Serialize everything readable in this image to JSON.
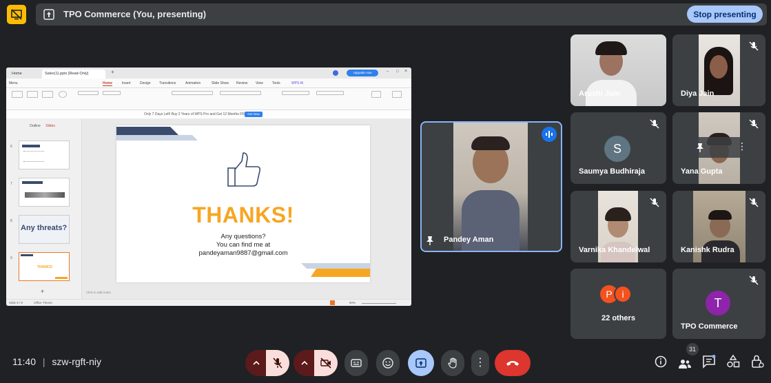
{
  "topbar": {
    "presenting_title": "TPO Commerce (You, presenting)",
    "stop_label": "Stop presenting"
  },
  "shared_screen": {
    "tabs": [
      "Home",
      "Sales(1).pptx [Read-Only]"
    ],
    "upgrade_label": "Upgrade now",
    "menu": [
      "Menu",
      "Home",
      "Insert",
      "Design",
      "Transitions",
      "Animation",
      "Slide Show",
      "Review",
      "View",
      "Tools",
      "WPS AI"
    ],
    "promo_text": "Only 7 Days Left! Buy 2 Years of WPS Pro and Get 12 Months FREE!",
    "promo_button": "Get Now",
    "panel_tabs": [
      "Outline",
      "Slides"
    ],
    "thumb_numbers": [
      "6",
      "7",
      "8",
      "9"
    ],
    "thumb_threats": "Any threats?",
    "thumb_thanks": "THANKS!",
    "notes_placeholder": "Click to add notes",
    "status_left": "Slide 9 / 9",
    "status_theme": "Office Theme",
    "zoom": "90%",
    "slide": {
      "title": "THANKS!",
      "line1": "Any questions?",
      "line2": "You can find me at",
      "line3": "pandeyaman9887@gmail.com"
    }
  },
  "participants": [
    {
      "name": "Pandey Aman"
    },
    {
      "name": "Arushi Jain"
    },
    {
      "name": "Diya Jain"
    },
    {
      "name": "Saumya Budhiraja",
      "initial": "S"
    },
    {
      "name": "Yana Gupta"
    },
    {
      "name": "Varnika Khandelwal"
    },
    {
      "name": "Kanishk Rudra"
    },
    {
      "name": "22 others",
      "initials": [
        "P",
        "i"
      ]
    },
    {
      "name": "TPO Commerce",
      "initial": "T"
    }
  ],
  "bottom": {
    "time": "11:40",
    "separator": "|",
    "meeting_code": "szw-rgft-niy",
    "people_count": "31"
  },
  "colors": {
    "background": "#202124",
    "tile": "#3c4043",
    "accent_blue": "#a8c7fa",
    "end_red": "#dc362e",
    "slide_orange": "#f6a623",
    "slide_navy": "#3a4b6e"
  }
}
